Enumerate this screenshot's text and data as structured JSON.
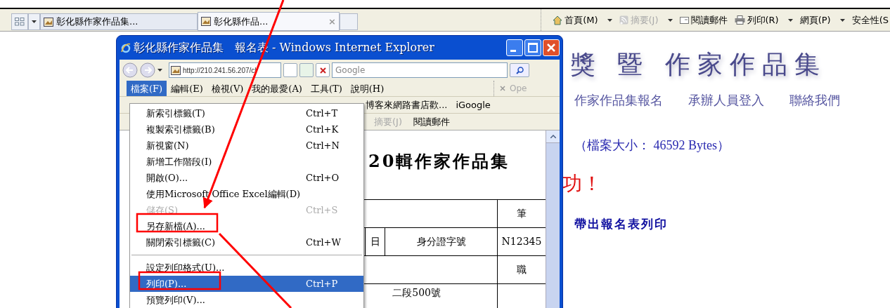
{
  "browser": {
    "tabs": [
      {
        "title": "彰化縣作家作品集...",
        "selected": false
      },
      {
        "title": "彰化縣作品...",
        "selected": true,
        "close": "×"
      }
    ],
    "commands": [
      {
        "label": "首頁(M)",
        "dropdown": true,
        "disabled": false
      },
      {
        "label": "摘要(J)",
        "dropdown": true,
        "disabled": true
      },
      {
        "label": "閱讀郵件",
        "dropdown": false,
        "disabled": false
      },
      {
        "label": "列印(R)",
        "dropdown": true,
        "disabled": false
      },
      {
        "label": "網頁(P)",
        "dropdown": true,
        "disabled": false
      },
      {
        "label": "安全性(S",
        "dropdown": false,
        "disabled": false
      }
    ]
  },
  "page": {
    "banner": "獎 暨 作家作品集",
    "nav": [
      "作家作品集報名",
      "承辦人員登入",
      "聯絡我們"
    ],
    "file_size": "（檔案大小： 46592 Bytes）",
    "success": "功！",
    "print_link": "帶出報名表列印"
  },
  "popup": {
    "title": "彰化縣作家作品集　報名表 - Windows Internet Explorer",
    "address": "http://210.241.56.207/cl",
    "search": {
      "placeholder": "Google"
    },
    "menus": [
      {
        "label": "檔案(F)",
        "selected": true
      },
      {
        "label": "編輯(E)",
        "selected": false
      },
      {
        "label": "檢視(V)",
        "selected": false
      },
      {
        "label": "我的最愛(A)",
        "selected": false
      },
      {
        "label": "工具(T)",
        "selected": false
      },
      {
        "label": "說明(H)",
        "selected": false
      }
    ],
    "toolbar_cut": "Ope",
    "favorites": [
      "博客來網路書店歡...",
      "iGoogle"
    ],
    "commands": [
      {
        "label": "摘要(J)",
        "disabled": true
      },
      {
        "label": "閱讀郵件",
        "disabled": false
      }
    ],
    "heading": "20輯作家作品集",
    "table": [
      {
        "kind": "right",
        "cells": [
          "筆"
        ]
      },
      {
        "kind": "triple",
        "cells": [
          "日",
          "身分證字號",
          "N12345"
        ]
      },
      {
        "kind": "right",
        "cells": [
          "職"
        ]
      },
      {
        "kind": "left",
        "cells": [
          "二段500號"
        ]
      }
    ],
    "file_menu": [
      {
        "kind": "item",
        "label": "新索引標籤(T)",
        "shortcut": "Ctrl+T",
        "disabled": false,
        "selected": false
      },
      {
        "kind": "item",
        "label": "複製索引標籤(B)",
        "shortcut": "Ctrl+K",
        "disabled": false,
        "selected": false
      },
      {
        "kind": "item",
        "label": "新視窗(N)",
        "shortcut": "Ctrl+N",
        "disabled": false,
        "selected": false
      },
      {
        "kind": "item",
        "label": "新增工作階段(I)",
        "disabled": false,
        "selected": false
      },
      {
        "kind": "item",
        "label": "開啟(O)...",
        "shortcut": "Ctrl+O",
        "disabled": false,
        "selected": false
      },
      {
        "kind": "item",
        "label": "使用Microsoft Office Excel編輯(D)",
        "disabled": false,
        "selected": false
      },
      {
        "kind": "item",
        "label": "儲存(S)",
        "shortcut": "Ctrl+S",
        "disabled": true,
        "selected": false
      },
      {
        "kind": "item",
        "label": "另存新檔(A)...",
        "disabled": false,
        "selected": false
      },
      {
        "kind": "item",
        "label": "關閉索引標籤(C)",
        "shortcut": "Ctrl+W",
        "disabled": false,
        "selected": false
      },
      {
        "kind": "separator"
      },
      {
        "kind": "item",
        "label": "設定列印格式(U)...",
        "disabled": false,
        "selected": false
      },
      {
        "kind": "item",
        "label": "列印(P)...",
        "shortcut": "Ctrl+P",
        "disabled": false,
        "selected": true
      },
      {
        "kind": "item",
        "label": "預覽列印(V)...",
        "disabled": false,
        "selected": false
      }
    ]
  }
}
